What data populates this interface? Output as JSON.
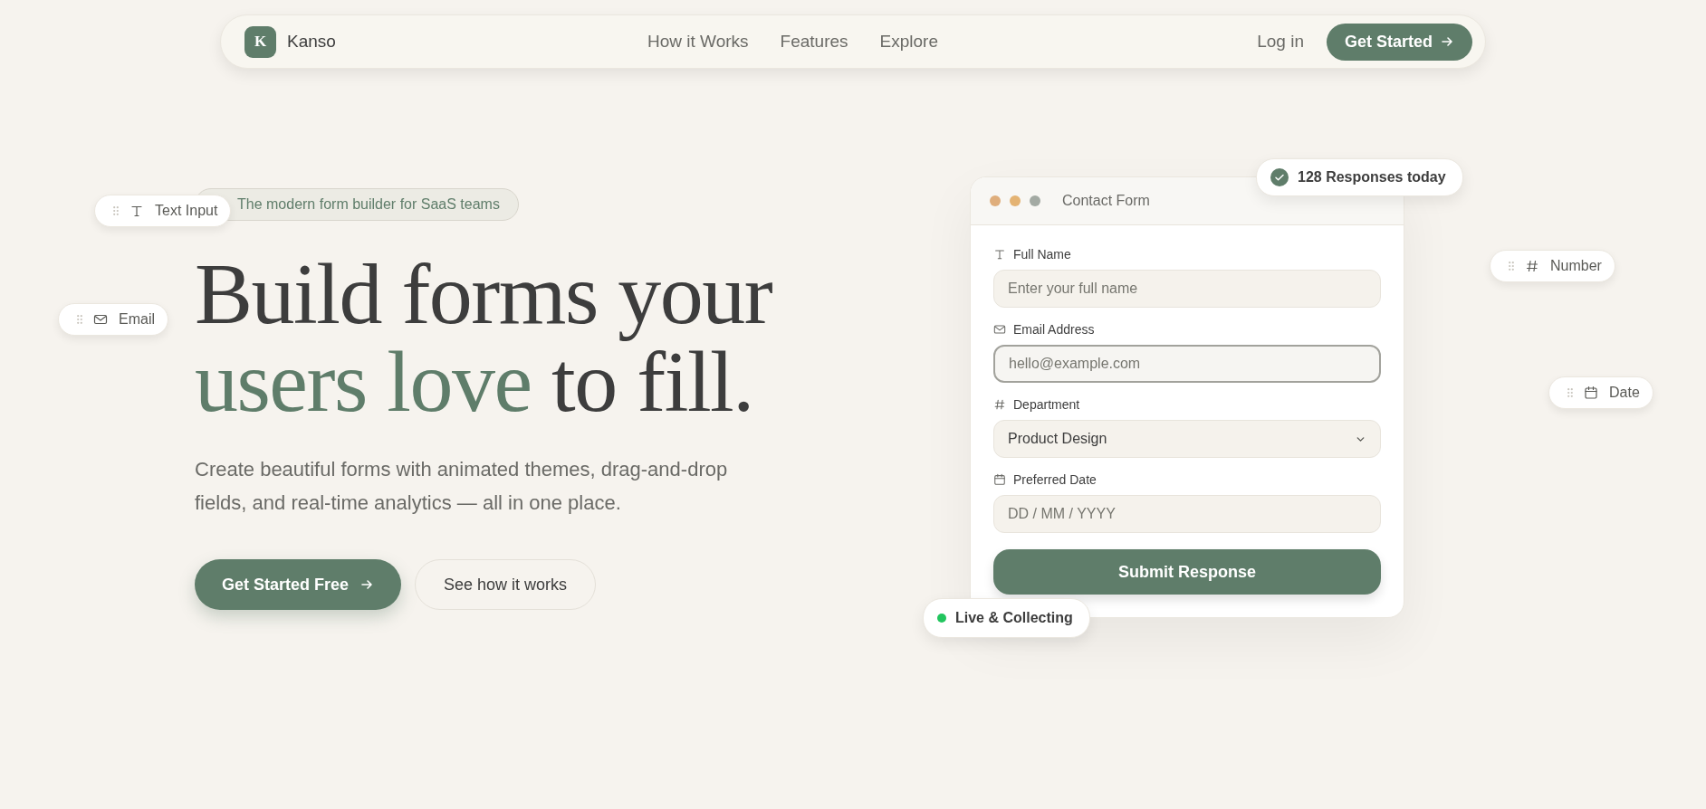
{
  "nav": {
    "brand_initial": "K",
    "brand": "Kanso",
    "links": [
      "How it Works",
      "Features",
      "Explore"
    ],
    "login": "Log in",
    "cta": "Get Started"
  },
  "hero": {
    "tagline": "The modern form builder for SaaS teams",
    "title_start": "Build forms your",
    "title_accent": "users love",
    "title_end": "to fill.",
    "description": "Create beautiful forms with animated themes, drag-and-drop fields, and real-time analytics — all in one place.",
    "primary_button": "Get Started Free",
    "secondary_button": "See how it works"
  },
  "floating_fields": [
    {
      "kind": "text",
      "label": "Text Input"
    },
    {
      "kind": "email",
      "label": "Email"
    },
    {
      "kind": "number",
      "label": "Number"
    },
    {
      "kind": "date",
      "label": "Date"
    }
  ],
  "form": {
    "title": "Contact Form",
    "fields": [
      {
        "kind": "text",
        "label": "Full Name",
        "placeholder": "Enter your full name",
        "focused": false
      },
      {
        "kind": "email",
        "label": "Email Address",
        "placeholder": "hello@example.com",
        "focused": true
      },
      {
        "kind": "select",
        "label": "Department",
        "value": "Product Design",
        "focused": false
      },
      {
        "kind": "date",
        "label": "Preferred Date",
        "placeholder": "DD / MM / YYYY",
        "focused": false
      }
    ],
    "submit": "Submit Response"
  },
  "badges": {
    "responses": "128 Responses today",
    "status": "Live & Collecting"
  }
}
